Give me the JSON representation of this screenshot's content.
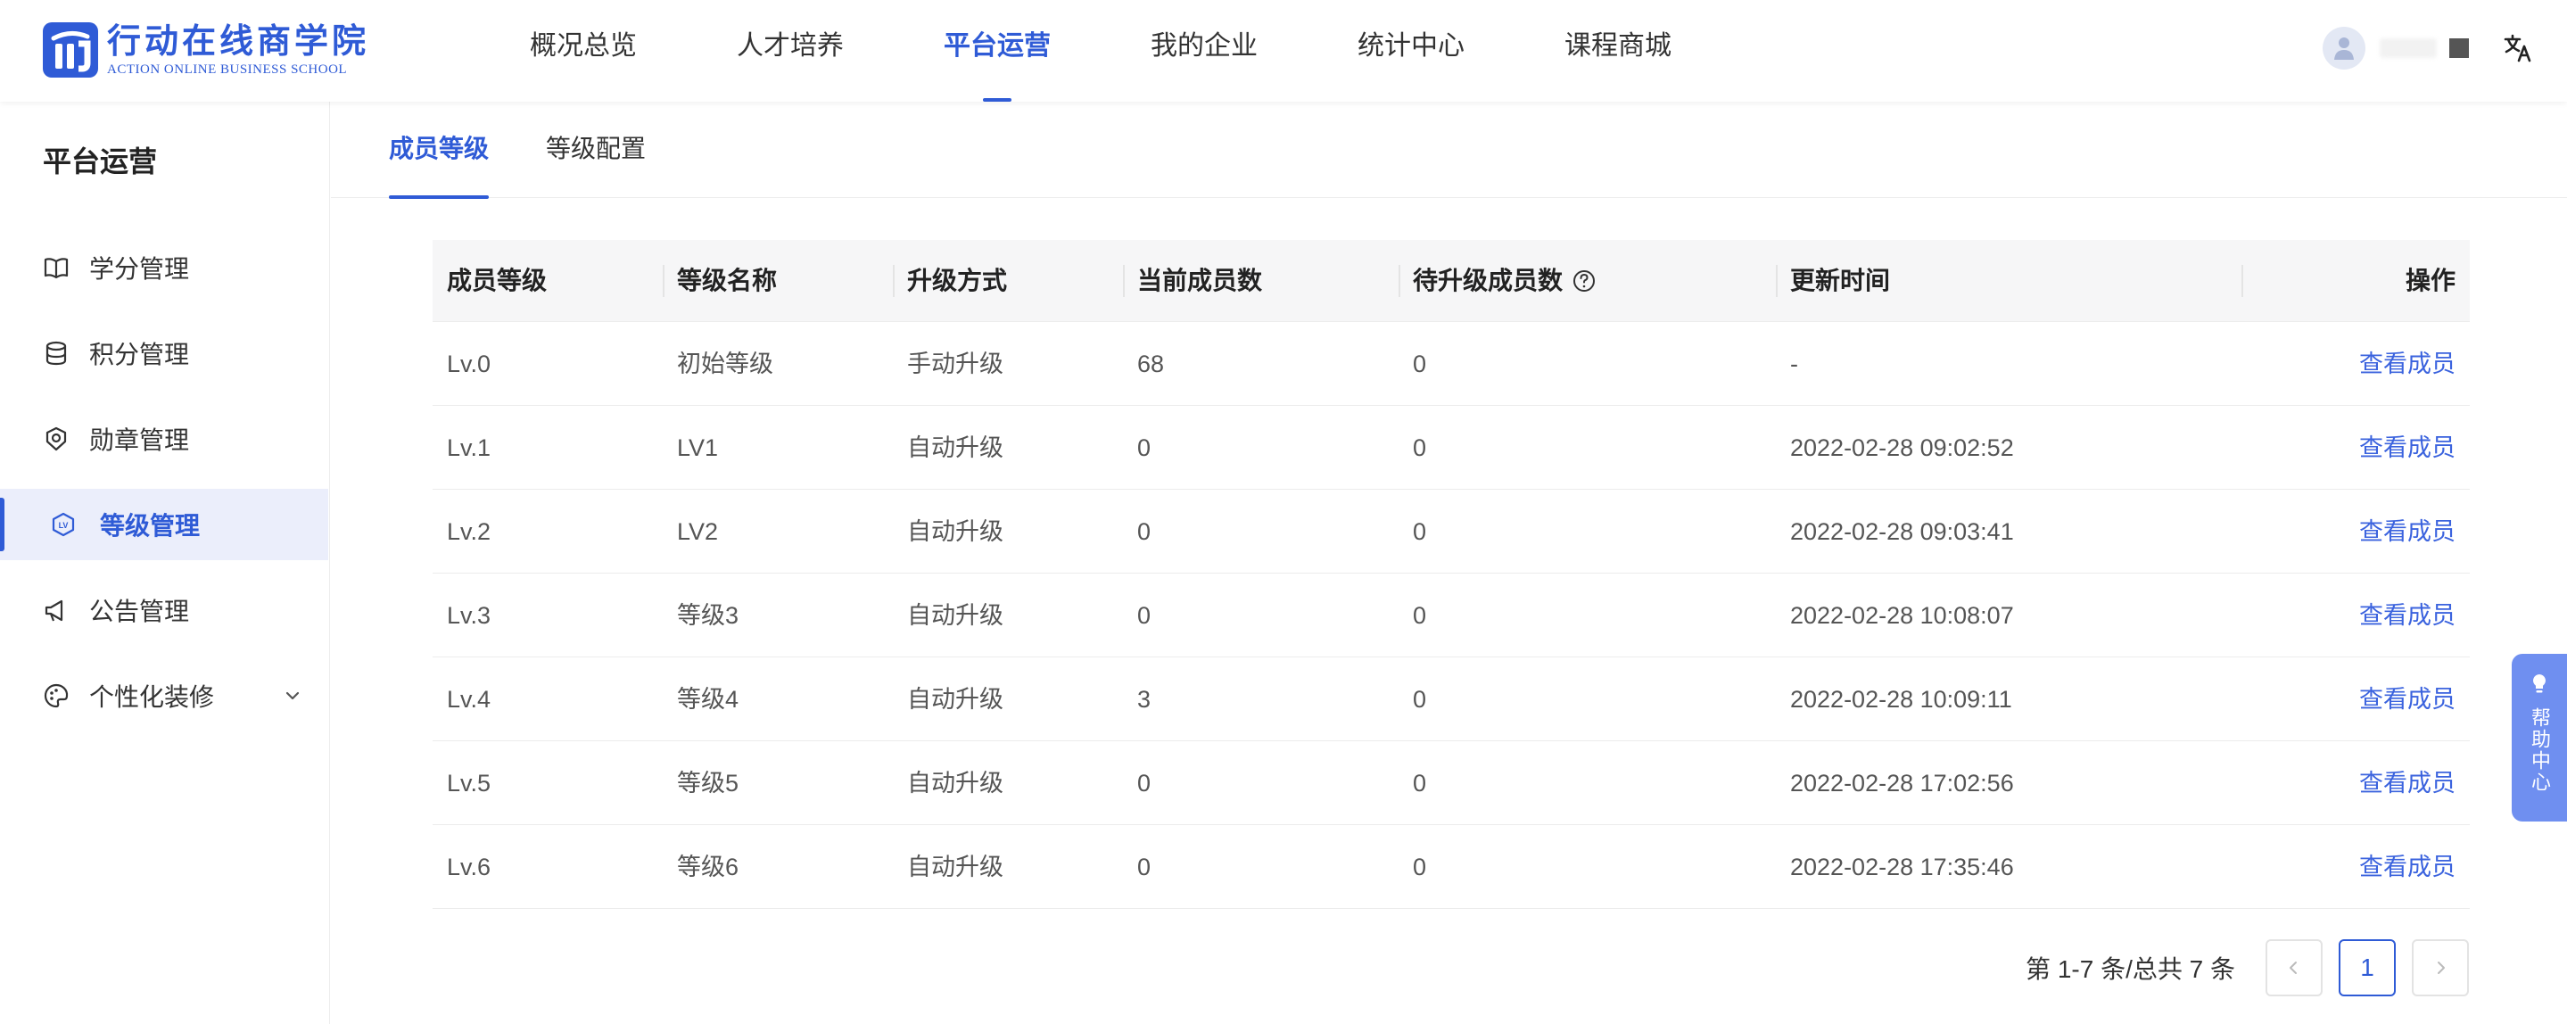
{
  "brand": {
    "name_cn": "行动在线商学院",
    "name_en": "ACTION ONLINE BUSINESS SCHOOL",
    "color": "#2f5bd6"
  },
  "nav": {
    "items": [
      {
        "label": "概况总览"
      },
      {
        "label": "人才培养"
      },
      {
        "label": "平台运营",
        "active": true
      },
      {
        "label": "我的企业"
      },
      {
        "label": "统计中心"
      },
      {
        "label": "课程商城"
      }
    ]
  },
  "sidebar": {
    "title": "平台运营",
    "items": [
      {
        "label": "学分管理",
        "icon": "book-icon"
      },
      {
        "label": "积分管理",
        "icon": "database-icon"
      },
      {
        "label": "勋章管理",
        "icon": "medal-icon"
      },
      {
        "label": "等级管理",
        "icon": "level-icon",
        "active": true
      },
      {
        "label": "公告管理",
        "icon": "megaphone-icon"
      },
      {
        "label": "个性化装修",
        "icon": "palette-icon",
        "expandable": true
      }
    ]
  },
  "tabs": [
    {
      "label": "成员等级",
      "active": true
    },
    {
      "label": "等级配置"
    }
  ],
  "table": {
    "headers": [
      "成员等级",
      "等级名称",
      "升级方式",
      "当前成员数",
      "待升级成员数",
      "更新时间",
      "操作"
    ],
    "rows": [
      [
        "Lv.0",
        "初始等级",
        "手动升级",
        "68",
        "0",
        "-",
        "查看成员"
      ],
      [
        "Lv.1",
        "LV1",
        "自动升级",
        "0",
        "0",
        "2022-02-28 09:02:52",
        "查看成员"
      ],
      [
        "Lv.2",
        "LV2",
        "自动升级",
        "0",
        "0",
        "2022-02-28 09:03:41",
        "查看成员"
      ],
      [
        "Lv.3",
        "等级3",
        "自动升级",
        "0",
        "0",
        "2022-02-28 10:08:07",
        "查看成员"
      ],
      [
        "Lv.4",
        "等级4",
        "自动升级",
        "3",
        "0",
        "2022-02-28 10:09:11",
        "查看成员"
      ],
      [
        "Lv.5",
        "等级5",
        "自动升级",
        "0",
        "0",
        "2022-02-28 17:02:56",
        "查看成员"
      ],
      [
        "Lv.6",
        "等级6",
        "自动升级",
        "0",
        "0",
        "2022-02-28 17:35:46",
        "查看成员"
      ]
    ]
  },
  "pagination": {
    "info": "第 1-7 条/总共 7 条",
    "current_page": "1",
    "prev_icon": "chevron-left-icon",
    "next_icon": "chevron-right-icon"
  },
  "help_center": {
    "label": "帮助中心",
    "icon": "lightbulb-icon"
  }
}
